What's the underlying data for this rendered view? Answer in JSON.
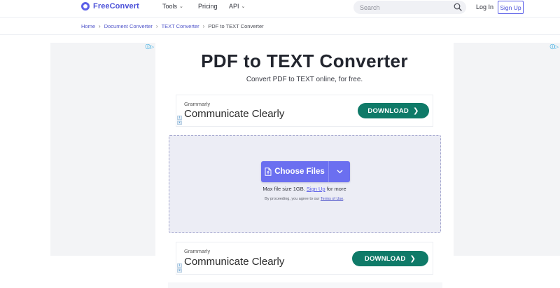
{
  "header": {
    "logo": "FreeConvert",
    "nav": [
      {
        "label": "Tools",
        "has_dropdown": true
      },
      {
        "label": "Pricing",
        "has_dropdown": false
      },
      {
        "label": "API",
        "has_dropdown": true
      }
    ],
    "search_placeholder": "Search",
    "login_label": "Log In",
    "signup_label": "Sign Up",
    "accent_color": "#5b5fe8"
  },
  "breadcrumb": {
    "items": [
      "Home",
      "Document Converter",
      "TEXT Converter"
    ],
    "current": "PDF to TEXT Converter"
  },
  "main": {
    "title": "PDF to TEXT Converter",
    "subtitle": "Convert PDF to TEXT online, for free."
  },
  "ads": {
    "top": {
      "brand": "Grammarly",
      "headline": "Communicate Clearly",
      "cta": "DOWNLOAD"
    },
    "bottom": {
      "brand": "Grammarly",
      "headline": "Communicate Clearly",
      "cta": "DOWNLOAD"
    },
    "cta_color": "#0f7a68"
  },
  "upload": {
    "button_label": "Choose Files",
    "max_size_prefix": "Max file size 1GB.",
    "signup_link": "Sign Up",
    "max_size_suffix": "for more",
    "terms_prefix": "By proceeding, you agree to our",
    "terms_link": "Terms of Use",
    "terms_suffix": "."
  }
}
